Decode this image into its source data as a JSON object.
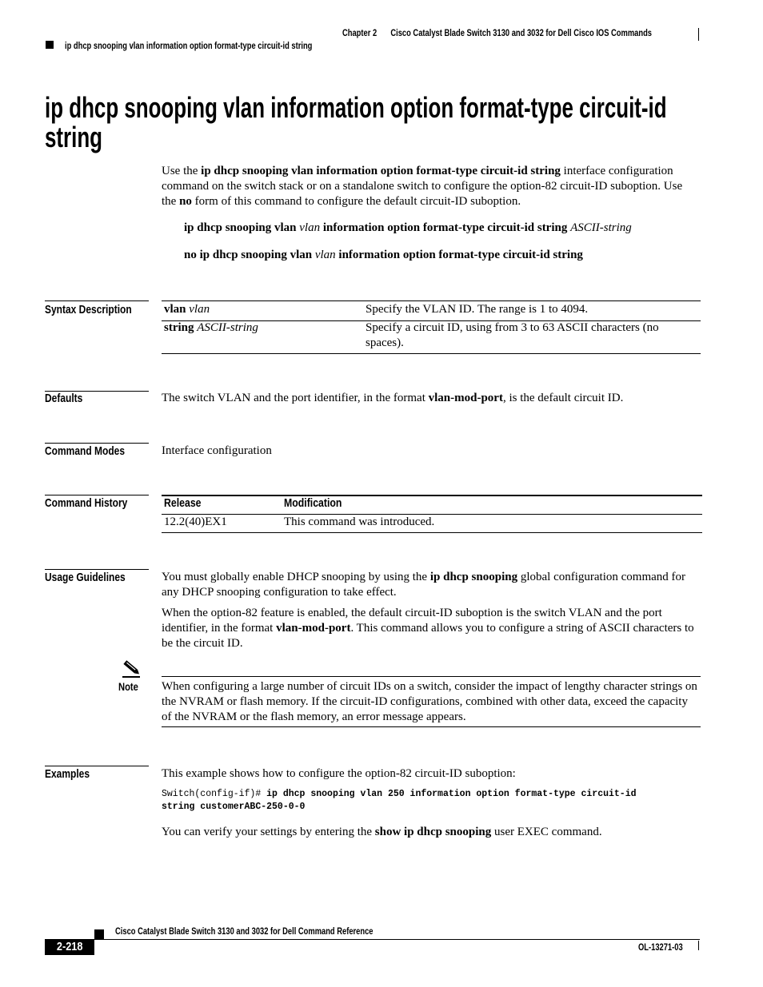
{
  "header": {
    "chapter": "Chapter 2",
    "book_section": "Cisco Catalyst Blade Switch 3130 and 3032 for Dell Cisco IOS Commands",
    "running_title": "ip dhcp snooping vlan information option format-type circuit-id string"
  },
  "title": "ip dhcp snooping vlan information option format-type circuit-id string",
  "intro": {
    "p1_a": "Use the ",
    "p1_cmd": "ip dhcp snooping vlan information option format-type circuit-id string",
    "p1_b": " interface configuration command on the switch stack or on a standalone switch to configure the option-82 circuit-ID suboption. Use the ",
    "p1_no": "no",
    "p1_c": " form of this command to configure the default circuit-ID suboption."
  },
  "syntax": {
    "line1_bold1": "ip dhcp snooping vlan",
    "line1_ital1": "vlan",
    "line1_bold2": "information option format-type circuit-id string",
    "line1_ital2": "ASCII-string",
    "line2_bold1": "no ip dhcp snooping vlan",
    "line2_ital1": "vlan",
    "line2_bold2": "information option format-type circuit-id string"
  },
  "sections": {
    "syntax_description": "Syntax Description",
    "defaults": "Defaults",
    "command_modes": "Command Modes",
    "command_history": "Command History",
    "usage_guidelines": "Usage Guidelines",
    "examples": "Examples"
  },
  "syntax_table": [
    {
      "kw": "vlan",
      "arg": "vlan",
      "desc": "Specify the VLAN ID. The range is 1 to 4094."
    },
    {
      "kw": "string",
      "arg": "ASCII-string",
      "desc": "Specify a circuit ID, using from 3 to 63 ASCII characters (no spaces)."
    }
  ],
  "defaults": {
    "a": "The switch VLAN and the port identifier, in the format ",
    "b": "vlan-mod-port",
    "c": ", is the default circuit ID."
  },
  "command_modes": "Interface configuration",
  "history": {
    "headers": [
      "Release",
      "Modification"
    ],
    "rows": [
      [
        "12.2(40)EX1",
        "This command was introduced."
      ]
    ]
  },
  "usage": {
    "p1_a": "You must globally enable DHCP snooping by using the ",
    "p1_b": "ip dhcp snooping",
    "p1_c": " global configuration command for any DHCP snooping configuration to take effect.",
    "p2_a": "When the option-82 feature is enabled, the default circuit-ID suboption is the switch VLAN and the port identifier, in the format ",
    "p2_b": "vlan-mod-port",
    "p2_c": ". This command allows you to configure a string of ASCII characters to be the circuit ID."
  },
  "note": {
    "label": "Note",
    "icon": "pencil-icon",
    "text": "When configuring a large number of circuit IDs on a switch, consider the impact of lengthy character strings on the NVRAM or flash memory. If the circuit-ID configurations, combined with other data, exceed the capacity of the NVRAM or the flash memory, an error message appears."
  },
  "examples": {
    "intro": "This example shows how to configure the option-82 circuit-ID suboption:",
    "prompt": "Switch(config-if)# ",
    "cmd1": "ip dhcp snooping vlan 250 information option format-type circuit-id",
    "cmd2": "string customerABC-250-0-0",
    "verify_a": "You can verify your settings by entering the ",
    "verify_b": "show ip dhcp snooping",
    "verify_c": " user EXEC command."
  },
  "footer": {
    "book_title": "Cisco Catalyst Blade Switch 3130 and 3032 for Dell Command Reference",
    "page": "2-218",
    "doc_id": "OL-13271-03"
  }
}
